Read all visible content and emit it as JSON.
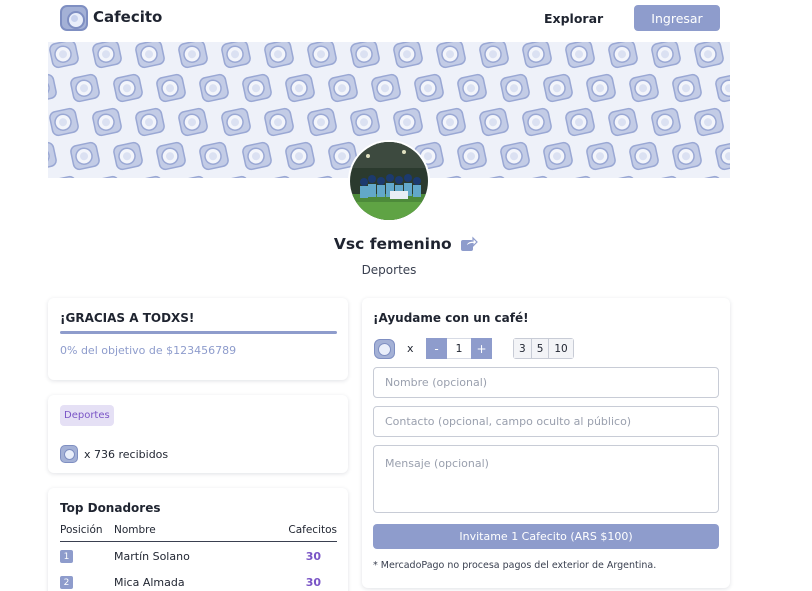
{
  "header": {
    "brand": "Cafecito",
    "nav_explore": "Explorar",
    "login": "Ingresar"
  },
  "profile": {
    "name": "Vsc femenino",
    "category": "Deportes"
  },
  "goal": {
    "title": "¡GRACIAS A TODXS!",
    "progress_text": "0% del objetivo de $123456789",
    "progress_percent": 0
  },
  "stats": {
    "tag": "Deportes",
    "received": "x 736 recibidos"
  },
  "donors": {
    "title": "Top Donadores",
    "columns": {
      "position": "Posición",
      "name": "Nombre",
      "cafecitos": "Cafecitos"
    },
    "rows": [
      {
        "position": "1",
        "name": "Martín Solano",
        "count": "30"
      },
      {
        "position": "2",
        "name": "Mica Almada",
        "count": "30"
      }
    ]
  },
  "form": {
    "title": "¡Ayudame con un café!",
    "times": "x",
    "minus": "-",
    "quantity": "1",
    "plus": "+",
    "quick_amounts": [
      "3",
      "5",
      "10"
    ],
    "name_placeholder": "Nombre (opcional)",
    "contact_placeholder": "Contacto (opcional, campo oculto al público)",
    "message_placeholder": "Mensaje (opcional)",
    "submit": "Invitame 1 Cafecito (ARS $100)",
    "disclaimer": "* MercadoPago no procesa pagos del exterior de Argentina."
  },
  "icons": {
    "logo": "coffee-cup-logo-icon",
    "share": "share-icon"
  },
  "colors": {
    "accent": "#8e9ccc",
    "purple_text": "#7a55c6",
    "tag_bg": "#e5e0f5",
    "banner_bg": "#eef1f9"
  }
}
